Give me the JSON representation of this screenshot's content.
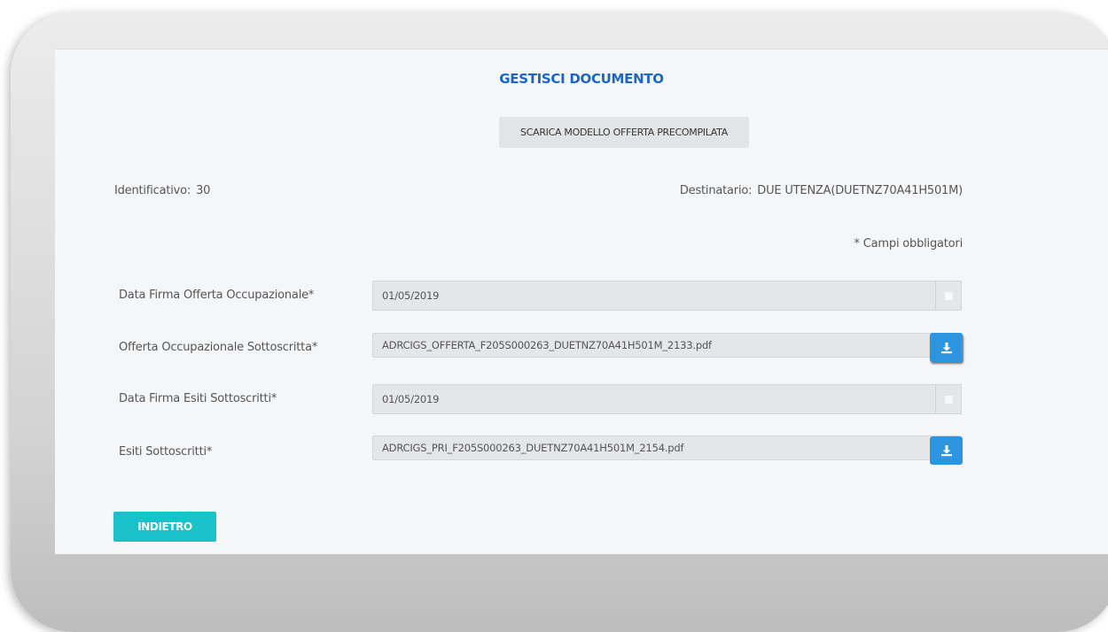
{
  "page": {
    "title": "GESTISCI DOCUMENTO",
    "download_template_label": "SCARICA MODELLO OFFERTA PRECOMPILATA"
  },
  "meta": {
    "identificativo_label": "Identificativo:",
    "identificativo_value": "30",
    "destinatario_label": "Destinatario:",
    "destinatario_value": "DUE UTENZA(DUETNZ70A41H501M)"
  },
  "form": {
    "required_note": "* Campi obbligatori",
    "data_firma_offerta": {
      "label": "Data Firma Offerta Occupazionale*",
      "value": "01/05/2019"
    },
    "offerta_sottoscritta": {
      "label": "Offerta Occupazionale Sottoscritta*",
      "value": "ADRCIGS_OFFERTA_F205S000263_DUETNZ70A41H501M_2133.pdf"
    },
    "data_firma_esiti": {
      "label": "Data Firma Esiti Sottoscritti*",
      "value": "01/05/2019"
    },
    "esiti_sottoscritti": {
      "label": "Esiti Sottoscritti*",
      "value": "ADRCIGS_PRI_F205S000263_DUETNZ70A41H501M_2154.pdf"
    }
  },
  "actions": {
    "back_label": "INDIETRO"
  },
  "icons": {
    "calendar": "calendar-icon",
    "download": "download-icon"
  },
  "colors": {
    "accent_blue": "#1b66c4",
    "download_button": "#2d95e0",
    "back_button": "#19c1c8"
  }
}
